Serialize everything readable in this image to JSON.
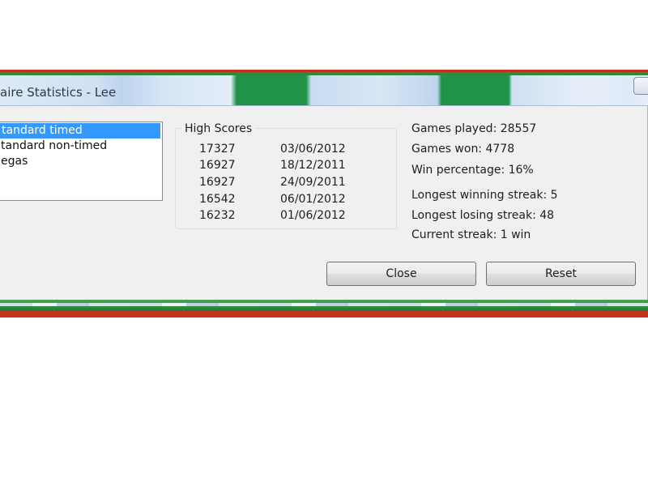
{
  "window": {
    "title": "aire Statistics - Lee"
  },
  "game_types": [
    {
      "label": "tandard timed",
      "selected": true
    },
    {
      "label": "tandard non-timed",
      "selected": false
    },
    {
      "label": "egas",
      "selected": false
    }
  ],
  "high_scores": {
    "title": "High Scores",
    "rows": [
      {
        "score": "17327",
        "date": "03/06/2012"
      },
      {
        "score": "16927",
        "date": "18/12/2011"
      },
      {
        "score": "16927",
        "date": "24/09/2011"
      },
      {
        "score": "16542",
        "date": "06/01/2012"
      },
      {
        "score": "16232",
        "date": "01/06/2012"
      }
    ]
  },
  "stats": {
    "games_played": "Games played: 28557",
    "games_won": "Games won: 4778",
    "win_percentage": "Win percentage: 16%",
    "longest_winning_streak": "Longest winning streak: 5",
    "longest_losing_streak": "Longest losing streak: 48",
    "current_streak": "Current streak: 1 win"
  },
  "buttons": {
    "close_label": "Close",
    "reset_label": "Reset"
  }
}
